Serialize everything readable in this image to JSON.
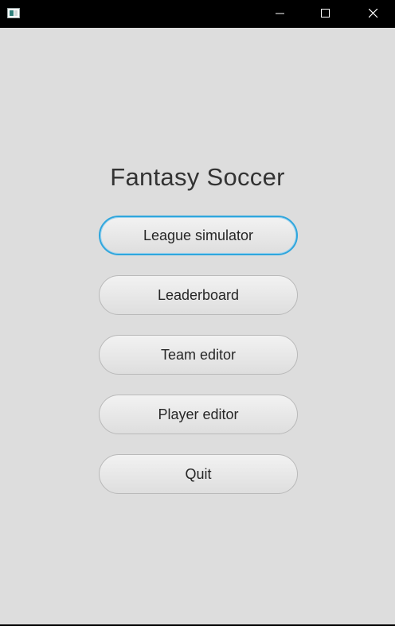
{
  "titlebar": {
    "icon": "app-window-icon",
    "controls": [
      "minimize-icon",
      "maximize-icon",
      "close-icon"
    ]
  },
  "main": {
    "title": "Fantasy Soccer",
    "buttons": [
      {
        "label": "League simulator",
        "focused": true
      },
      {
        "label": "Leaderboard",
        "focused": false
      },
      {
        "label": "Team editor",
        "focused": false
      },
      {
        "label": "Player editor",
        "focused": false
      },
      {
        "label": "Quit",
        "focused": false
      }
    ]
  },
  "colors": {
    "background": "#dddddd",
    "titlebar": "#000000",
    "focus_ring": "#2fa6dd",
    "text": "#333333"
  }
}
